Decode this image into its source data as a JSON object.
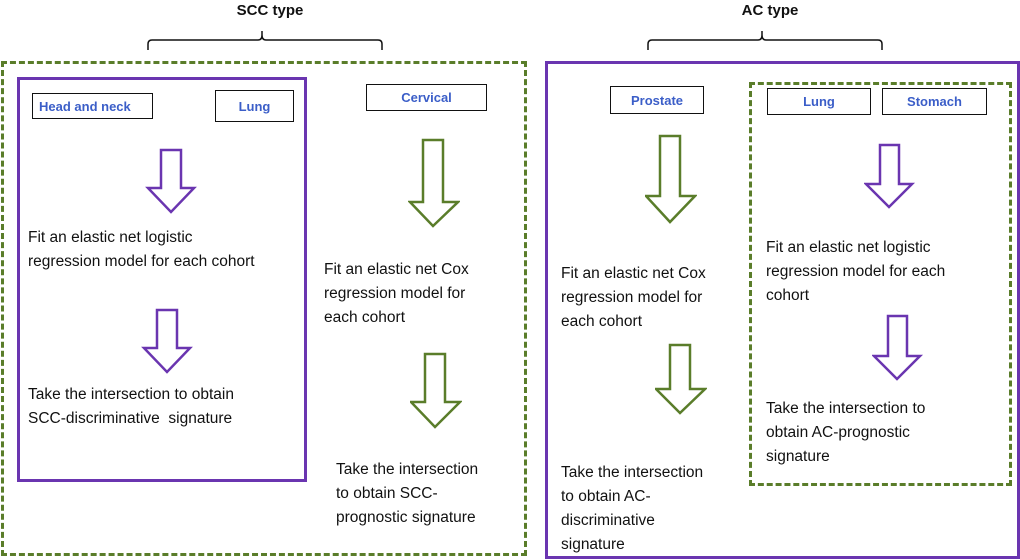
{
  "colors": {
    "purple": "#6a35b0",
    "green": "#5a7d2a",
    "label_text": "#3b5ec8"
  },
  "groups": {
    "scc": {
      "title": "SCC type",
      "discriminative": {
        "cohorts": [
          "Head and neck",
          "Lung"
        ],
        "step1": "Fit an elastic net logistic regression model for each cohort",
        "step1_lines": [
          "Fit an elastic net logistic",
          "regression model for each cohort"
        ],
        "step2_lines": [
          "Take the intersection to obtain",
          "SCC-discriminative  signature"
        ]
      },
      "prognostic": {
        "cohorts": [
          "Cervical"
        ],
        "step1_lines": [
          "Fit an elastic net Cox",
          "regression model for",
          "each cohort"
        ],
        "step2_lines": [
          "Take the intersection",
          "to obtain SCC-",
          "prognostic signature"
        ]
      }
    },
    "ac": {
      "title": "AC type",
      "discriminative": {
        "cohorts": [
          "Prostate"
        ],
        "step1_lines": [
          "Fit an elastic net Cox",
          "regression model for",
          "each cohort"
        ],
        "step2_lines": [
          "Take the intersection",
          "to obtain AC-",
          "discriminative",
          "signature"
        ]
      },
      "prognostic": {
        "cohorts": [
          "Lung",
          "Stomach"
        ],
        "step1_lines": [
          "Fit an elastic net logistic",
          "regression model for each",
          "cohort"
        ],
        "step2_lines": [
          "Take the intersection to",
          "obtain AC-prognostic",
          "signature"
        ]
      }
    }
  }
}
